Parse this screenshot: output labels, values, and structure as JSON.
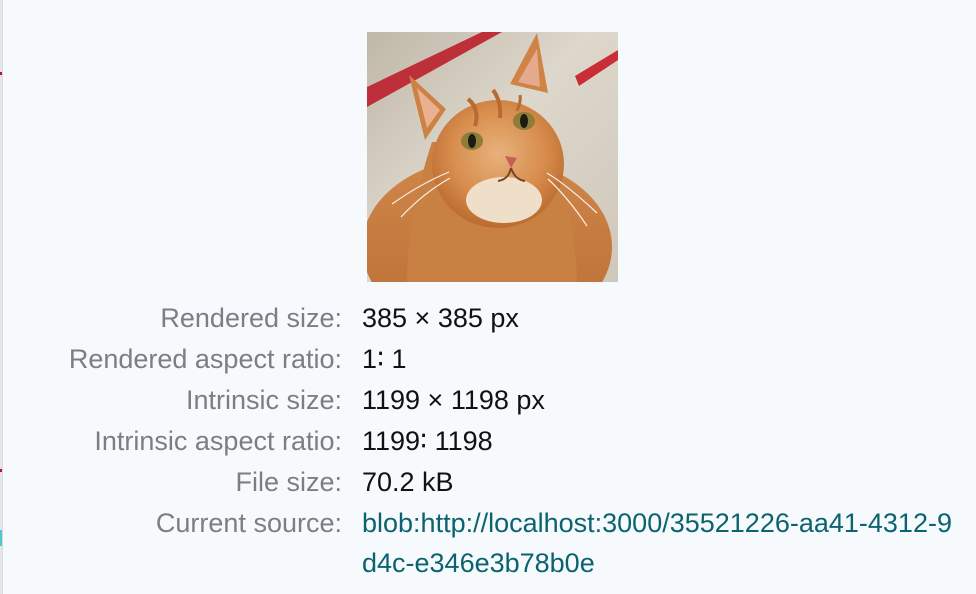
{
  "window": {
    "background": "#f6fafd",
    "label_color": "#7b7f84",
    "value_color": "#111111",
    "link_color": "#0b6370"
  },
  "preview": {
    "alt": "orange tabby cat",
    "icon": "image-preview"
  },
  "details": {
    "rendered_size": {
      "label": "Rendered size:",
      "value": "385 × 385 px"
    },
    "rendered_aspect_ratio": {
      "label": "Rendered aspect ratio:",
      "value": "1∶ 1"
    },
    "intrinsic_size": {
      "label": "Intrinsic size:",
      "value": "1199 × 1198 px"
    },
    "intrinsic_aspect_ratio": {
      "label": "Intrinsic aspect ratio:",
      "value": "1199∶ 1198"
    },
    "file_size": {
      "label": "File size:",
      "value": "70.2 kB"
    },
    "current_source": {
      "label": "Current source:",
      "value": "blob:http://localhost:3000/35521226-aa41-4312-9d4c-e346e3b78b0e"
    }
  }
}
